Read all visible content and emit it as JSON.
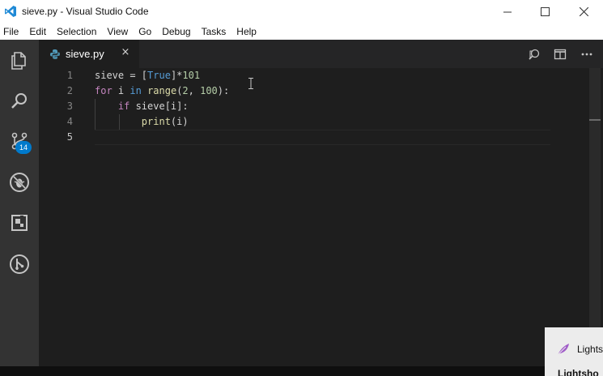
{
  "window": {
    "title": "sieve.py - Visual Studio Code"
  },
  "menu": [
    "File",
    "Edit",
    "Selection",
    "View",
    "Go",
    "Debug",
    "Tasks",
    "Help"
  ],
  "activity_bar": {
    "items": [
      "explorer-icon",
      "search-icon",
      "source-control-icon",
      "debug-icon",
      "extensions-icon",
      "git-lens-icon"
    ],
    "source_control_badge": "14"
  },
  "tabs": [
    {
      "label": "sieve.py",
      "close": "×"
    }
  ],
  "editor": {
    "line_numbers": [
      "1",
      "2",
      "3",
      "4",
      "5"
    ],
    "active_line": "5"
  },
  "popup": {
    "text": "Lights",
    "text2": "Lightsho"
  },
  "colors": {
    "editor_bg": "#1e1e1e",
    "activity_bar": "#333333",
    "badge": "#007acc",
    "keyword": "#569cd6",
    "control_keyword": "#c586c0",
    "function": "#dcdcaa",
    "number": "#b5cea8"
  }
}
